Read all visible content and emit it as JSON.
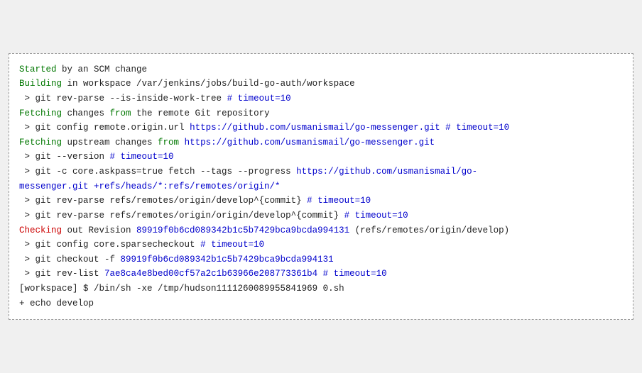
{
  "terminal": {
    "lines": [
      {
        "id": "line-01",
        "segments": [
          {
            "text": "Started",
            "color": "green"
          },
          {
            "text": " by an SCM change",
            "color": "default"
          }
        ]
      },
      {
        "id": "line-02",
        "segments": [
          {
            "text": "Building",
            "color": "green"
          },
          {
            "text": " in workspace /var/jenkins/jobs/build-go-auth/workspace",
            "color": "default"
          }
        ]
      },
      {
        "id": "line-03",
        "segments": [
          {
            "text": " > git rev-parse --is-inside-work-tree ",
            "color": "default"
          },
          {
            "text": "# timeout=10",
            "color": "blue"
          }
        ]
      },
      {
        "id": "line-04",
        "segments": [
          {
            "text": "Fetching",
            "color": "green"
          },
          {
            "text": " changes ",
            "color": "default"
          },
          {
            "text": "from",
            "color": "green"
          },
          {
            "text": " the remote Git repository",
            "color": "default"
          }
        ]
      },
      {
        "id": "line-05",
        "segments": [
          {
            "text": " > git config remote.origin.url ",
            "color": "default"
          },
          {
            "text": "https://github.com/usmanismail/go-messenger.git",
            "color": "blue"
          },
          {
            "text": " ",
            "color": "default"
          },
          {
            "text": "# timeout=10",
            "color": "blue"
          }
        ]
      },
      {
        "id": "line-06",
        "segments": [
          {
            "text": "Fetching",
            "color": "green"
          },
          {
            "text": " upstream changes ",
            "color": "default"
          },
          {
            "text": "from",
            "color": "green"
          },
          {
            "text": " ",
            "color": "default"
          },
          {
            "text": "https://github.com/usmanismail/go-messenger.git",
            "color": "blue"
          }
        ]
      },
      {
        "id": "line-07",
        "segments": [
          {
            "text": " > git --version ",
            "color": "default"
          },
          {
            "text": "# timeout=10",
            "color": "blue"
          }
        ]
      },
      {
        "id": "line-08",
        "segments": [
          {
            "text": " > git -c core.askpass=true fetch --tags --progress ",
            "color": "default"
          },
          {
            "text": "https://github.com/usmanismail/go-",
            "color": "blue"
          }
        ]
      },
      {
        "id": "line-09",
        "segments": [
          {
            "text": "messenger.git +refs/heads/*:refs/remotes/origin/*",
            "color": "blue"
          }
        ]
      },
      {
        "id": "line-10",
        "segments": [
          {
            "text": " > git rev-parse refs/remotes/origin/develop^{commit} ",
            "color": "default"
          },
          {
            "text": "# timeout=10",
            "color": "blue"
          }
        ]
      },
      {
        "id": "line-11",
        "segments": [
          {
            "text": " > git rev-parse refs/remotes/origin/origin/develop^{commit} ",
            "color": "default"
          },
          {
            "text": "# timeout=10",
            "color": "blue"
          }
        ]
      },
      {
        "id": "line-12",
        "segments": [
          {
            "text": "Checking",
            "color": "red"
          },
          {
            "text": " out Revision ",
            "color": "default"
          },
          {
            "text": "89919f0b6cd089342b1c5b7429bca9bcda994131",
            "color": "blue"
          },
          {
            "text": " (refs/remotes/origin/develop)",
            "color": "default"
          }
        ]
      },
      {
        "id": "line-13",
        "segments": [
          {
            "text": " > git config core.sparsecheckout ",
            "color": "default"
          },
          {
            "text": "# timeout=10",
            "color": "blue"
          }
        ]
      },
      {
        "id": "line-14",
        "segments": [
          {
            "text": " > git checkout -f ",
            "color": "default"
          },
          {
            "text": "89919f0b6cd089342b1c5b7429bca9bcda994131",
            "color": "blue"
          }
        ]
      },
      {
        "id": "line-15",
        "segments": [
          {
            "text": " > git rev-list ",
            "color": "default"
          },
          {
            "text": "7ae8ca4e8bed00cf57a2c1b63966e208773361b4",
            "color": "blue"
          },
          {
            "text": " ",
            "color": "default"
          },
          {
            "text": "# timeout=10",
            "color": "blue"
          }
        ]
      },
      {
        "id": "line-16",
        "segments": [
          {
            "text": "[workspace] $ /bin/sh -xe /tmp/hudson1111260089955841969 0.sh",
            "color": "default"
          }
        ]
      },
      {
        "id": "line-17",
        "segments": [
          {
            "text": "+ echo develop",
            "color": "default"
          }
        ]
      }
    ]
  }
}
